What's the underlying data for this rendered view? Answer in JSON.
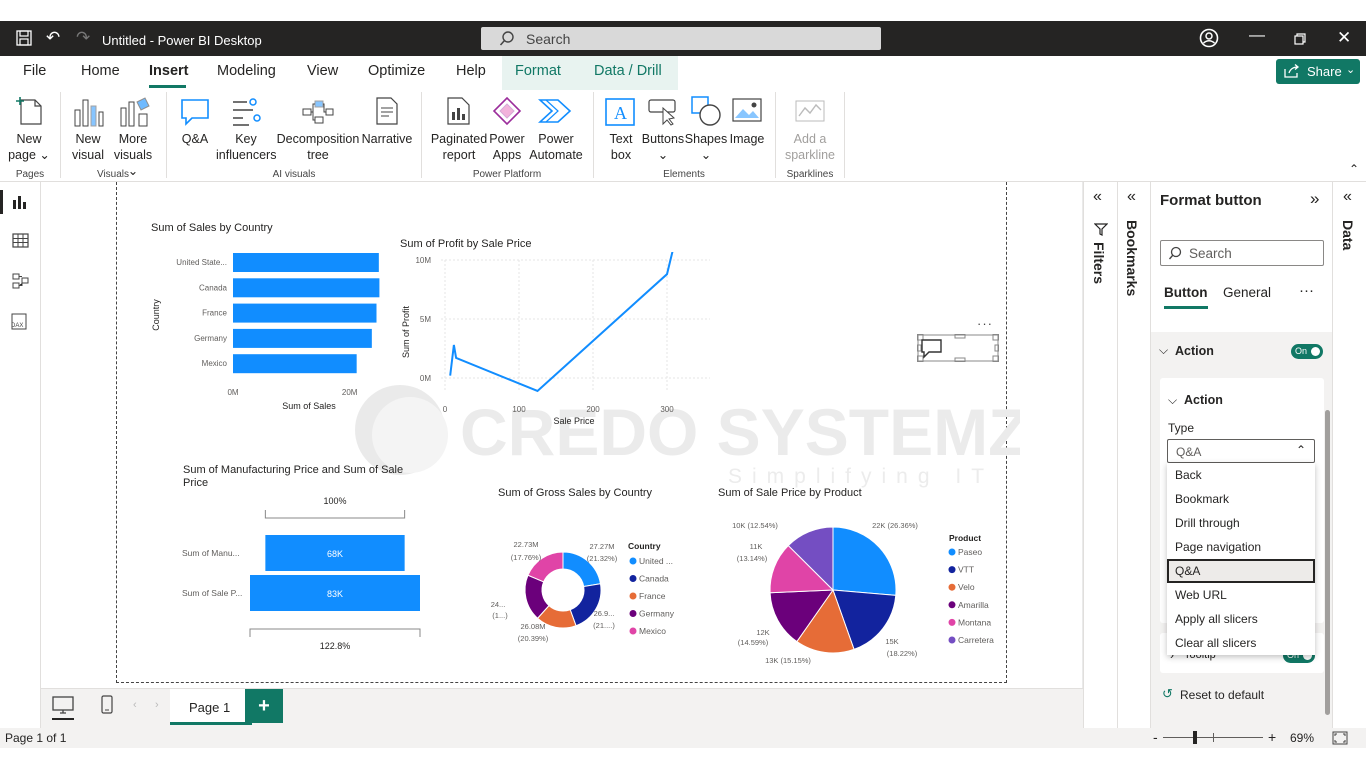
{
  "window": {
    "title": "Untitled - Power BI Desktop",
    "search_placeholder": "Search"
  },
  "menu": {
    "tabs": [
      "File",
      "Home",
      "Insert",
      "Modeling",
      "View",
      "Optimize",
      "Help",
      "Format",
      "Data / Drill"
    ],
    "share_label": "Share"
  },
  "ribbon": {
    "new_page": "New page",
    "new_visual": "New visual",
    "more_visuals": "More visuals",
    "qa": "Q&A",
    "key_influencers": "Key influencers",
    "decomposition_tree": "Decomposition tree",
    "narrative": "Narrative",
    "paginated_report": "Paginated report",
    "power_apps": "Power Apps",
    "power_automate": "Power Automate",
    "text_box": "Text box",
    "buttons": "Buttons",
    "shapes": "Shapes",
    "image": "Image",
    "add_sparkline": "Add a sparkline",
    "groups": {
      "pages": "Pages",
      "visuals": "Visuals",
      "ai_visuals": "AI visuals",
      "power_platform": "Power Platform",
      "elements": "Elements",
      "sparklines": "Sparklines"
    }
  },
  "charts": {
    "bar_title": "Sum of Sales by Country",
    "bar_ylabel": "Country",
    "bar_xlabel": "Sum of Sales",
    "line_title": "Sum of Profit by Sale Price",
    "line_ylabel": "Sum of Profit",
    "line_xlabel": "Sale Price",
    "funnel_title": "Sum of Manufacturing Price and Sum of Sale Price",
    "donut_title": "Sum of Gross Sales by Country",
    "pie_title": "Sum of Sale Price by Product"
  },
  "chart_data": [
    {
      "type": "bar",
      "title": "Sum of Sales by Country",
      "categories": [
        "United State...",
        "Canada",
        "France",
        "Germany",
        "Mexico"
      ],
      "values": [
        25.0,
        25.1,
        24.6,
        23.8,
        21.2
      ],
      "xlabel": "Sum of Sales",
      "ylabel": "Country",
      "xticks": [
        "0M",
        "20M"
      ],
      "xlim": [
        0,
        30
      ]
    },
    {
      "type": "line",
      "title": "Sum of Profit by Sale Price",
      "x": [
        7,
        12,
        15,
        125,
        300,
        350
      ],
      "y": [
        0.2,
        2.8,
        1.7,
        -1.1,
        8.8,
        21.7
      ],
      "xlabel": "Sale Price",
      "ylabel": "Sum of Profit",
      "xticks": [
        "0",
        "100",
        "200",
        "300"
      ],
      "yticks": [
        "0M",
        "5M",
        "10M"
      ]
    },
    {
      "type": "bar",
      "title": "Sum of Manufacturing Price and Sum of Sale Price",
      "categories": [
        "Sum of Manu...",
        "Sum of Sale P..."
      ],
      "values": [
        68,
        83
      ],
      "labels": [
        "68K",
        "83K"
      ],
      "top_label": "100%",
      "bottom_label": "122.8%"
    },
    {
      "type": "pie",
      "title": "Sum of Gross Sales by Country",
      "legend_title": "Country",
      "categories": [
        "United ...",
        "Canada",
        "France",
        "Germany",
        "Mexico"
      ],
      "colors": [
        "#118dff",
        "#12239e",
        "#e66c37",
        "#6b007b",
        "#e044a7"
      ],
      "values": [
        27.27,
        26.9,
        21.0,
        24.0,
        22.73
      ],
      "labels": [
        "27.27M (21.32%)",
        "26.9... (21....)",
        "26.08M (20.39%)",
        "24... (1...)",
        "22.73M (17.76%)"
      ]
    },
    {
      "type": "pie",
      "title": "Sum of Sale Price by Product",
      "legend_title": "Product",
      "categories": [
        "Paseo",
        "VTT",
        "Velo",
        "Amarilla",
        "Montana",
        "Carretera"
      ],
      "colors": [
        "#118dff",
        "#12239e",
        "#e66c37",
        "#6b007b",
        "#e044a7",
        "#744ec2"
      ],
      "values": [
        26.36,
        18.22,
        15.15,
        14.59,
        13.14,
        12.54
      ],
      "labels": [
        "22K (26.36%)",
        "15K (18.22%)",
        "13K (15.15%)",
        "12K (14.59%)",
        "11K (13.14%)",
        "10K (12.54%)"
      ]
    }
  ],
  "chart_labels": {
    "bar_xticks": [
      "0M",
      "20M"
    ],
    "line_yticks": [
      "10M",
      "5M",
      "0M"
    ],
    "line_xticks": [
      "0",
      "100",
      "200",
      "300"
    ],
    "funnel_top": "100%",
    "funnel_bottom": "122.8%",
    "funnel_cats": [
      "Sum of Manu...",
      "Sum of Sale P..."
    ],
    "funnel_vals": [
      "68K",
      "83K"
    ],
    "donut_legend_title": "Country",
    "donut_legend": [
      "United ...",
      "Canada",
      "France",
      "Germany",
      "Mexico"
    ],
    "donut_labels": [
      "22.73M",
      "(17.76%)",
      "27.27M",
      "(21.32%)",
      "24...",
      "(1...)",
      "26.9...",
      "(21....)",
      "26.08M",
      "(20.39%)"
    ],
    "pie_legend_title": "Product",
    "pie_legend": [
      "Paseo",
      "VTT",
      "Velo",
      "Amarilla",
      "Montana",
      "Carretera"
    ],
    "pie_labels": [
      "10K (12.54%)",
      "22K (26.36%)",
      "11K",
      "(13.14%)",
      "12K",
      "(14.59%)",
      "15K",
      "(18.22%)",
      "13K (15.15%)"
    ]
  },
  "watermark": {
    "line1": "CREDO SYSTEMZ",
    "line2": "Simplifying IT"
  },
  "side_panes": {
    "filters": "Filters",
    "bookmarks": "Bookmarks",
    "data": "Data"
  },
  "format_pane": {
    "title": "Format button",
    "search_placeholder": "Search",
    "tab_button": "Button",
    "tab_general": "General",
    "more": "···",
    "action_section": "Action",
    "action_toggle": "On",
    "action_sub": "Action",
    "type_label": "Type",
    "type_value": "Q&A",
    "options": [
      "Back",
      "Bookmark",
      "Drill through",
      "Page navigation",
      "Q&A",
      "Web URL",
      "Apply all slicers",
      "Clear all slicers"
    ],
    "tooltip_label": "Tooltip",
    "tooltip_toggle": "On",
    "reset": "Reset to default"
  },
  "page_tabs": {
    "page1": "Page 1",
    "add": "+"
  },
  "status": {
    "page_info": "Page 1 of 1",
    "zoom": "69%",
    "minus": "-",
    "plus": "+"
  }
}
